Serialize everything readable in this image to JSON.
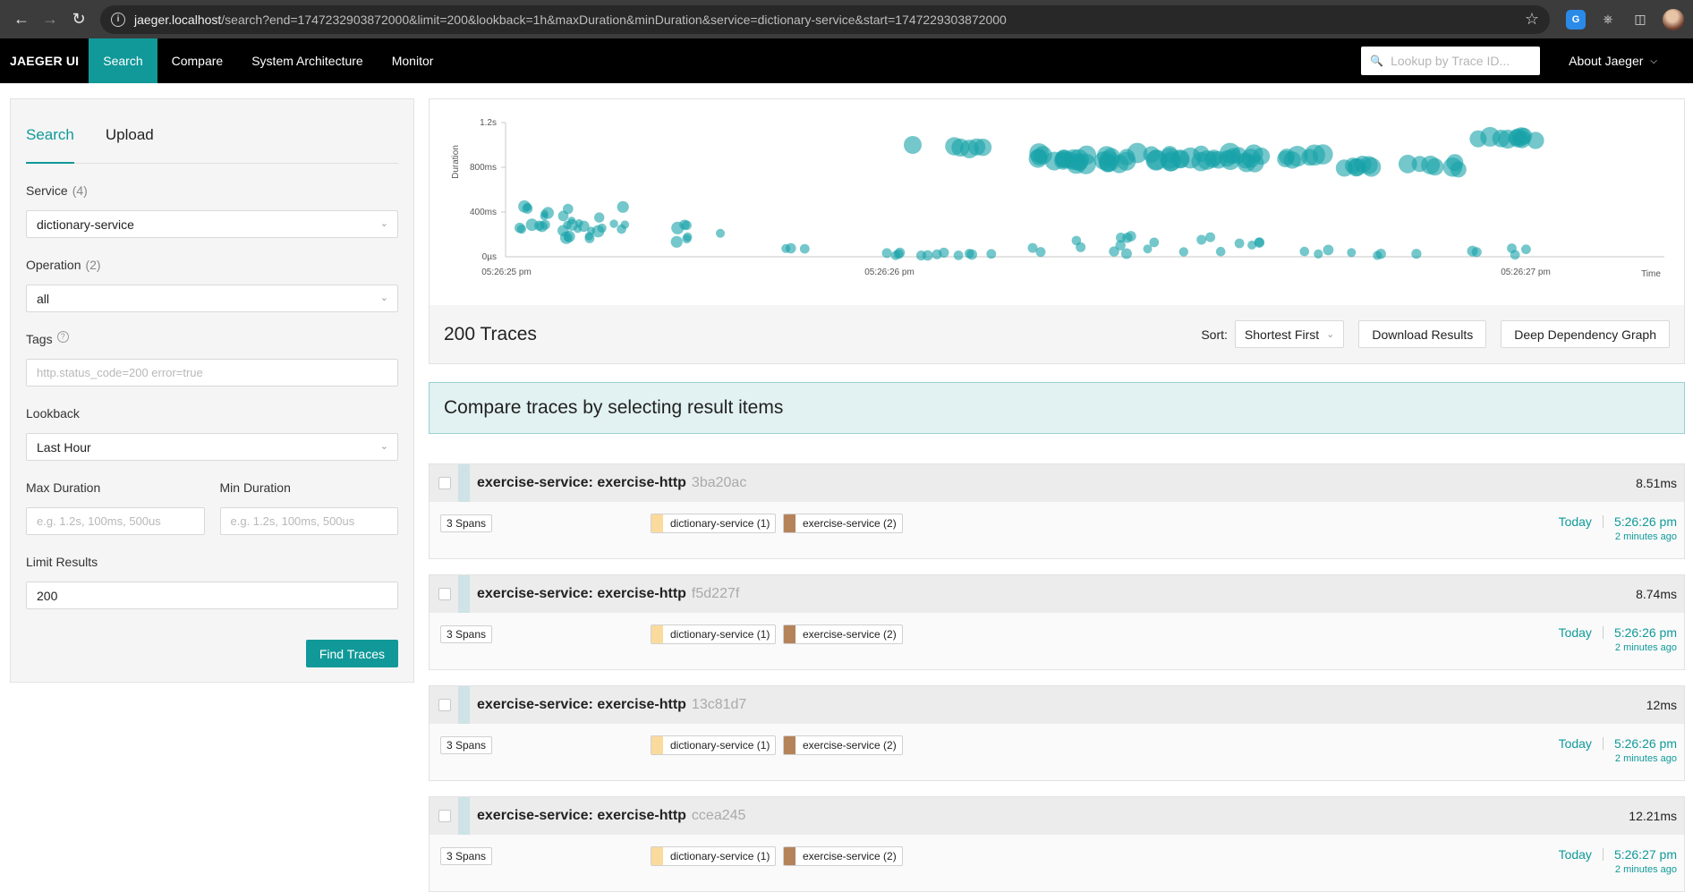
{
  "browser": {
    "url_host": "jaeger.localhost",
    "url_rest": "/search?end=1747232903872000&limit=200&lookback=1h&maxDuration&minDuration&service=dictionary-service&start=1747229303872000"
  },
  "nav": {
    "brand": "JAEGER UI",
    "items": [
      "Search",
      "Compare",
      "System Architecture",
      "Monitor"
    ],
    "lookup_placeholder": "Lookup by Trace ID...",
    "about": "About Jaeger"
  },
  "search": {
    "tabs": [
      "Search",
      "Upload"
    ],
    "service_label": "Service",
    "service_count": "(4)",
    "service_value": "dictionary-service",
    "operation_label": "Operation",
    "operation_count": "(2)",
    "operation_value": "all",
    "tags_label": "Tags",
    "tags_placeholder": "http.status_code=200 error=true",
    "lookback_label": "Lookback",
    "lookback_value": "Last Hour",
    "max_label": "Max Duration",
    "min_label": "Min Duration",
    "duration_placeholder": "e.g. 1.2s, 100ms, 500us",
    "limit_label": "Limit Results",
    "limit_value": "200",
    "find_button": "Find Traces"
  },
  "chart_data": {
    "type": "scatter",
    "ylabel": "Duration",
    "xlabel": "Time",
    "y_ticks": [
      "0µs",
      "400ms",
      "800ms",
      "1.2s"
    ],
    "x_ticks": [
      "05:26:25 pm",
      "05:26:26 pm",
      "05:26:27 pm"
    ],
    "ylim_ms": [
      0,
      1200
    ],
    "color": "#17a2a8"
  },
  "results": {
    "count_label": "200 Traces",
    "sort_label": "Sort:",
    "sort_value": "Shortest First",
    "download": "Download Results",
    "ddg": "Deep Dependency Graph",
    "compare_banner": "Compare traces by selecting result items"
  },
  "traces": [
    {
      "name": "exercise-service: exercise-http",
      "id": "3ba20ac",
      "duration": "8.51ms",
      "spans": "3 Spans",
      "svc1": "dictionary-service (1)",
      "svc2": "exercise-service (2)",
      "day": "Today",
      "time": "5:26:26 pm",
      "ago": "2 minutes ago"
    },
    {
      "name": "exercise-service: exercise-http",
      "id": "f5d227f",
      "duration": "8.74ms",
      "spans": "3 Spans",
      "svc1": "dictionary-service (1)",
      "svc2": "exercise-service (2)",
      "day": "Today",
      "time": "5:26:26 pm",
      "ago": "2 minutes ago"
    },
    {
      "name": "exercise-service: exercise-http",
      "id": "13c81d7",
      "duration": "12ms",
      "spans": "3 Spans",
      "svc1": "dictionary-service (1)",
      "svc2": "exercise-service (2)",
      "day": "Today",
      "time": "5:26:26 pm",
      "ago": "2 minutes ago"
    },
    {
      "name": "exercise-service: exercise-http",
      "id": "ccea245",
      "duration": "12.21ms",
      "spans": "3 Spans",
      "svc1": "dictionary-service (1)",
      "svc2": "exercise-service (2)",
      "day": "Today",
      "time": "5:26:27 pm",
      "ago": "2 minutes ago"
    }
  ],
  "colors": {
    "accent": "#119999",
    "svc1": "#fbdb9d",
    "svc2": "#b5835a"
  }
}
